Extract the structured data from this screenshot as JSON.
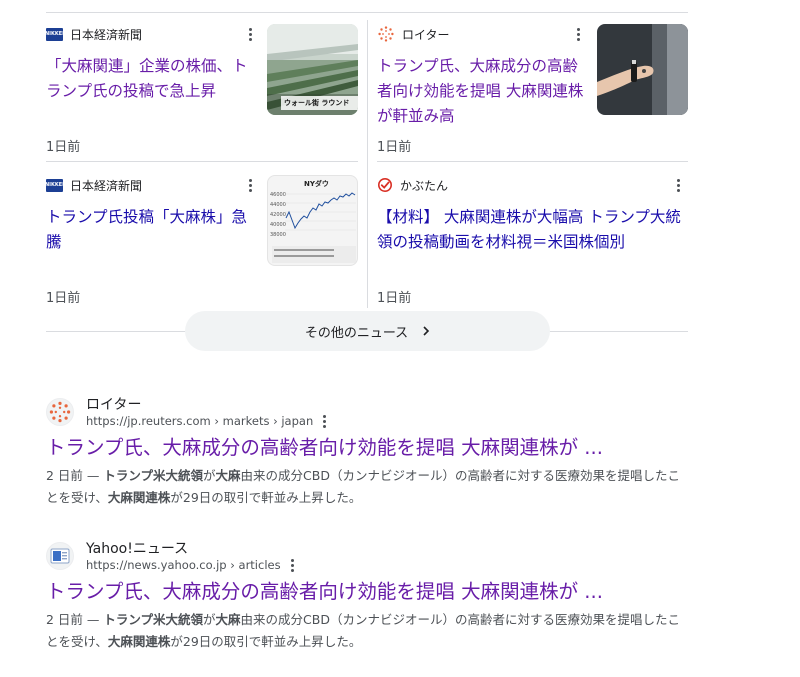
{
  "news": {
    "cards": [
      {
        "source": "日本経済新聞",
        "title": "「大麻関連」企業の株価、トランプ氏の投稿で急上昇",
        "date": "1日前",
        "thumb_caption": "ウォール街 ラウンド"
      },
      {
        "source": "ロイター",
        "title": "トランプ氏、大麻成分の高齢者向け効能を提唱 大麻関連株が軒並み高",
        "date": "1日前"
      },
      {
        "source": "日本経済新聞",
        "title": "トランプ氏投稿「大麻株」急騰",
        "date": "1日前",
        "thumb_caption": "NYダウ",
        "thumb_axis": [
          "46000",
          "44000",
          "42000",
          "40000",
          "38000"
        ]
      },
      {
        "source": "かぶたん",
        "title": "【材料】 大麻関連株が大幅高 トランプ大統領の投稿動画を材料視＝米国株個別",
        "date": "1日前"
      }
    ],
    "more_label": "その他のニュース"
  },
  "results": [
    {
      "site": "ロイター",
      "url": "https://jp.reuters.com › markets › japan",
      "title": "トランプ氏、大麻成分の高齢者向け効能を提唱 大麻関連株が ...",
      "snippet_date": "2 日前 — ",
      "snippet_b1": "トランプ米大統領",
      "snippet_t1": "が",
      "snippet_b2": "大麻",
      "snippet_t2": "由来の成分CBD（カンナビジオール）の高齢者に対する医療効果を提唱したことを受け、",
      "snippet_b3": "大麻関連株",
      "snippet_t3": "が29日の取引で軒並み上昇した。"
    },
    {
      "site": "Yahoo!ニュース",
      "url": "https://news.yahoo.co.jp › articles",
      "title": "トランプ氏、大麻成分の高齢者向け効能を提唱 大麻関連株が ...",
      "snippet_date": "2 日前 — ",
      "snippet_b1": "トランプ米大統領",
      "snippet_t1": "が",
      "snippet_b2": "大麻",
      "snippet_t2": "由来の成分CBD（カンナビジオール）の高齢者に対する医療効果を提唱したことを受け、",
      "snippet_b3": "大麻関連株",
      "snippet_t3": "が29日の取引で軒並み上昇した。"
    }
  ],
  "colors": {
    "link": "#1a0dab",
    "visited": "#681da8",
    "nikkei": "#1c3f94",
    "reuters": "#e8663d",
    "kabutan": "#d93025"
  }
}
